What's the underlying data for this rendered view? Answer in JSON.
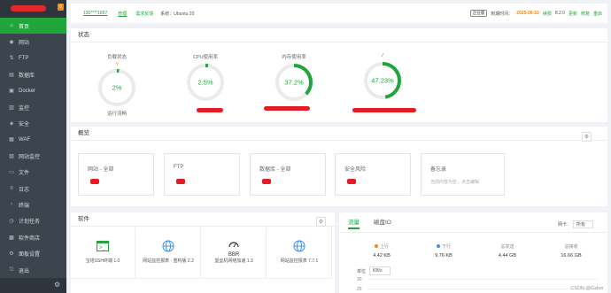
{
  "sidebar": {
    "badge": "0",
    "items": [
      {
        "label": "首页",
        "icon": "home-icon",
        "glyph": "⌂",
        "active": true
      },
      {
        "label": "网站",
        "icon": "globe-icon",
        "glyph": "◉"
      },
      {
        "label": "FTP",
        "icon": "ftp-icon",
        "glyph": "⇅"
      },
      {
        "label": "数据库",
        "icon": "database-icon",
        "glyph": "▤"
      },
      {
        "label": "Docker",
        "icon": "docker-icon",
        "glyph": "▣"
      },
      {
        "label": "监控",
        "icon": "monitor-icon",
        "glyph": "▥"
      },
      {
        "label": "安全",
        "icon": "shield-icon",
        "glyph": "◈"
      },
      {
        "label": "WAF",
        "icon": "waf-icon",
        "glyph": "▦"
      },
      {
        "label": "网站监控",
        "icon": "site-monitor-icon",
        "glyph": "▧"
      },
      {
        "label": "文件",
        "icon": "folder-icon",
        "glyph": "▭"
      },
      {
        "label": "日志",
        "icon": "log-icon",
        "glyph": "≡"
      },
      {
        "label": "终端",
        "icon": "terminal-icon",
        "glyph": "›"
      },
      {
        "label": "计划任务",
        "icon": "clock-icon",
        "glyph": "◷"
      },
      {
        "label": "软件商店",
        "icon": "store-icon",
        "glyph": "▩"
      },
      {
        "label": "面板设置",
        "icon": "settings-icon",
        "glyph": "⚙"
      },
      {
        "label": "退出",
        "icon": "logout-icon",
        "glyph": "⎋"
      }
    ]
  },
  "topbar": {
    "user": "130****1897",
    "tag": "管理",
    "sys_link": "需求反馈",
    "sys_value": "系统：Ubuntu 20",
    "enterprise": "企业版",
    "expire_label": "到期时间：",
    "expire_date": "2025-06-10",
    "renew": "续费",
    "version": "8.2.0",
    "update": "更新",
    "repair": "修复",
    "restart": "重启"
  },
  "status": {
    "title": "状态",
    "gauges": [
      {
        "label": "负载状态",
        "value": "2%",
        "percent": 2,
        "sub": "运行流畅"
      },
      {
        "label": "CPU使用率",
        "value": "2.5%",
        "percent": 2.5,
        "sub": ""
      },
      {
        "label": "内存使用率",
        "value": "37.2%",
        "percent": 37.2,
        "sub": ""
      },
      {
        "label": "/",
        "value": "47.23%",
        "percent": 47.23,
        "sub": ""
      }
    ],
    "colors": {
      "accent": "#20a53a",
      "warn": "#f0881a",
      "redact": "#e51c23"
    }
  },
  "overview": {
    "title": "概览",
    "cards": [
      {
        "title": "网站 - 全部"
      },
      {
        "title": "FTP"
      },
      {
        "title": "数据库 - 全部"
      },
      {
        "title": "安全风险"
      },
      {
        "title": "备忘录",
        "hint": "当前内容为空，点击编辑"
      }
    ]
  },
  "software": {
    "title": "软件",
    "items": [
      {
        "name": "宝塔SSH终端 1.0",
        "icon": "terminal-app-icon"
      },
      {
        "name": "网站监控报表 - 重构版 2.2",
        "icon": "globe-app-icon"
      },
      {
        "name": "堡垒机网络加速 1.3",
        "icon": "bbr-app-icon",
        "badge": "BBR"
      },
      {
        "name": "网站监控报表 7.7.1",
        "icon": "globe-app-icon"
      }
    ]
  },
  "traffic": {
    "tabs": [
      "流量",
      "磁盘IO"
    ],
    "node_label": "网卡：",
    "node_value": "所有",
    "stats": [
      {
        "label": "上行",
        "value": "4.42 KB",
        "dot": "#f0881a"
      },
      {
        "label": "下行",
        "value": "9.76 KB",
        "dot": "#3b8ff0"
      },
      {
        "label": "总发送",
        "value": "4.44 GB"
      },
      {
        "label": "总接收",
        "value": "16.66 GB"
      }
    ],
    "unit_label": "单位",
    "unit_value": "KB/s",
    "y_ticks": [
      "30",
      "25"
    ]
  },
  "watermark": "CSDN @Gxber"
}
